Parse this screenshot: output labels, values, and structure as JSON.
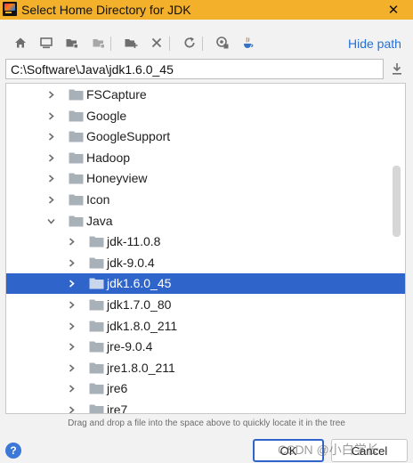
{
  "window": {
    "title": "Select Home Directory for JDK",
    "close_glyph": "✕"
  },
  "toolbar": {
    "buttons": [
      {
        "name": "home-icon"
      },
      {
        "name": "desktop-icon"
      },
      {
        "name": "project-folder-icon"
      },
      {
        "name": "module-folder-icon"
      },
      {
        "name": "new-folder-icon"
      },
      {
        "name": "delete-icon"
      },
      {
        "name": "refresh-icon"
      },
      {
        "name": "show-hidden-icon"
      },
      {
        "name": "java-home-icon"
      }
    ],
    "hide_path_label": "Hide path"
  },
  "path": {
    "value": "C:\\Software\\Java\\jdk1.6.0_45"
  },
  "tree": {
    "items": [
      {
        "label": "FSCapture",
        "level": 0,
        "expanded": false,
        "selected": false
      },
      {
        "label": "Google",
        "level": 0,
        "expanded": false,
        "selected": false
      },
      {
        "label": "GoogleSupport",
        "level": 0,
        "expanded": false,
        "selected": false
      },
      {
        "label": "Hadoop",
        "level": 0,
        "expanded": false,
        "selected": false
      },
      {
        "label": "Honeyview",
        "level": 0,
        "expanded": false,
        "selected": false
      },
      {
        "label": "Icon",
        "level": 0,
        "expanded": false,
        "selected": false
      },
      {
        "label": "Java",
        "level": 0,
        "expanded": true,
        "selected": false
      },
      {
        "label": "jdk-11.0.8",
        "level": 1,
        "expanded": false,
        "selected": false
      },
      {
        "label": "jdk-9.0.4",
        "level": 1,
        "expanded": false,
        "selected": false
      },
      {
        "label": "jdk1.6.0_45",
        "level": 1,
        "expanded": false,
        "selected": true
      },
      {
        "label": "jdk1.7.0_80",
        "level": 1,
        "expanded": false,
        "selected": false
      },
      {
        "label": "jdk1.8.0_211",
        "level": 1,
        "expanded": false,
        "selected": false
      },
      {
        "label": "jre-9.0.4",
        "level": 1,
        "expanded": false,
        "selected": false
      },
      {
        "label": "jre1.8.0_211",
        "level": 1,
        "expanded": false,
        "selected": false
      },
      {
        "label": "jre6",
        "level": 1,
        "expanded": false,
        "selected": false
      },
      {
        "label": "jre7",
        "level": 1,
        "expanded": false,
        "selected": false
      }
    ]
  },
  "hint": "Drag and drop a file into the space above to quickly locate it in the tree",
  "footer": {
    "help_glyph": "?",
    "ok_label": "OK",
    "cancel_label": "Cancel",
    "watermark": "CSDN @小白学长"
  },
  "colors": {
    "titlebar": "#f3b02b",
    "selection": "#2f65ca",
    "link": "#2470d6",
    "folder": "#a9b1b8",
    "icon": "#6e6e6e"
  }
}
